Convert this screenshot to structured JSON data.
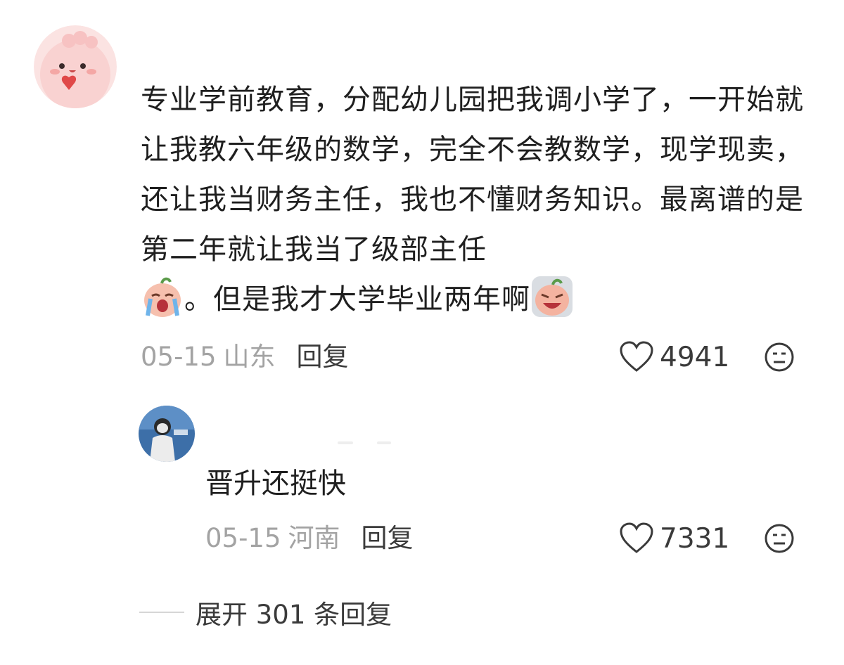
{
  "comment": {
    "text_before_emoji": "专业学前教育，分配幼儿园把我调小学了，一开始就让我教六年级的数学，完全不会教数学，现学现卖，还让我当财务主任，我也不懂财务知识。最离谱的是第二年就让我当了级部主任",
    "text_between_emojis": "。但是我才大学毕业两年啊",
    "date": "05-15",
    "location": "山东",
    "reply_label": "回复",
    "likes": "4941"
  },
  "reply": {
    "text": "晋升还挺快",
    "date": "05-15",
    "location": "河南",
    "reply_label": "回复",
    "likes": "7331"
  },
  "expand": {
    "label": "展开 301 条回复"
  },
  "colors": {
    "meta_gray": "#a3a3a3",
    "text_dark": "#1f1f1f",
    "avatar_pink": "#f9dad9",
    "emoji_peach": "#f6b9a8"
  }
}
